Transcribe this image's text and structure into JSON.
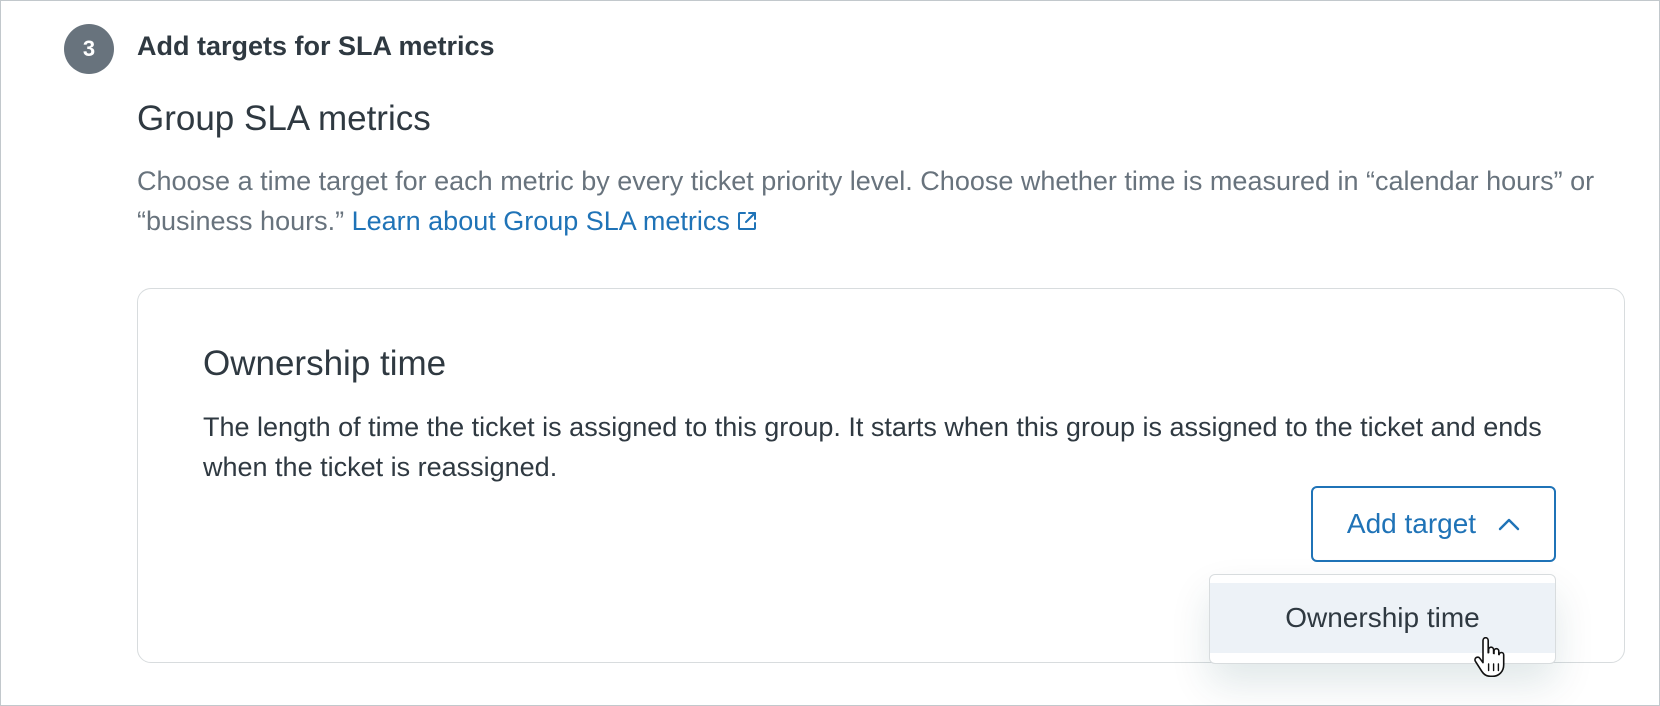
{
  "step": {
    "number": "3",
    "title": "Add targets for SLA metrics"
  },
  "section": {
    "title": "Group SLA metrics",
    "description": "Choose a time target for each metric by every ticket priority level. Choose whether time is measured in “calendar hours” or “business hours.”",
    "link_label": "Learn about Group SLA metrics",
    "link_icon": "external-link-icon"
  },
  "card": {
    "title": "Ownership time",
    "description": "The length of time the ticket is assigned to this group. It starts when this group is assigned to the ticket and ends when the ticket is reassigned.",
    "add_button_label": "Add target",
    "add_button_icon": "chevron-up-icon"
  },
  "dropdown": {
    "items": [
      {
        "label": "Ownership time",
        "highlighted": true
      }
    ]
  },
  "colors": {
    "accent": "#1f73b7",
    "badge": "#68737d",
    "text": "#2f3941",
    "muted": "#68737d",
    "highlight": "#edf2f7"
  }
}
